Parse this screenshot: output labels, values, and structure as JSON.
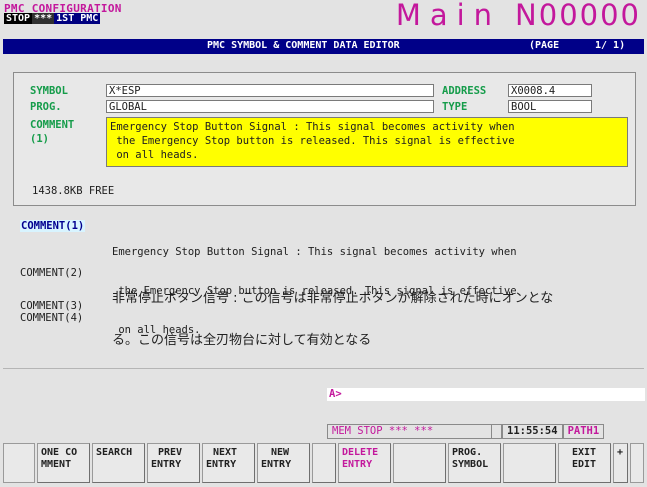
{
  "header": {
    "title": "PMC CONFIGURATION",
    "mode": "STOP",
    "mode_flags": "***",
    "pmc": "1ST PMC",
    "program_label": "Main",
    "program_number": "N00000"
  },
  "title_bar": {
    "title": "PMC SYMBOL & COMMENT DATA EDITOR",
    "page_label": "(PAGE",
    "page_value": "1/  1)"
  },
  "editor": {
    "symbol_label": "SYMBOL",
    "symbol_value": "X*ESP",
    "address_label": "ADDRESS",
    "address_value": "X0008.4",
    "prog_label": "PROG.",
    "prog_value": "GLOBAL",
    "type_label": "TYPE",
    "type_value": "BOOL",
    "comment_label": "COMMENT",
    "comment_index": "(1)",
    "comment_lines": [
      "Emergency Stop Button Signal : This signal becomes activity when",
      " the Emergency Stop button is released. This signal is effective",
      " on all heads."
    ],
    "free_memory": "1438.8KB FREE"
  },
  "comments": [
    {
      "label": "COMMENT(1)",
      "lines": [
        "Emergency Stop Button Signal : This signal becomes activity when",
        " the Emergency Stop button is released. This signal is effective",
        " on all heads."
      ]
    },
    {
      "label": "COMMENT(2)",
      "lines": [
        "非常停止ボタン信号 : この信号は非常停止ボタンが解除された時にオンとな",
        "る。この信号は全刃物台に対して有効となる"
      ]
    },
    {
      "label": "COMMENT(3)",
      "lines": []
    },
    {
      "label": "COMMENT(4)",
      "lines": []
    }
  ],
  "input_prompt": "A>",
  "status_bar": {
    "mode": "MEM  STOP *** ***",
    "time": "11:55:54",
    "path": "PATH1"
  },
  "softkeys": [
    {
      "line1": "ONE CO",
      "line2": "MMENT"
    },
    {
      "line1": "SEARCH",
      "line2": ""
    },
    {
      "line1": "PREV",
      "line2": "ENTRY"
    },
    {
      "line1": "NEXT",
      "line2": "ENTRY"
    },
    {
      "line1": "NEW",
      "line2": "ENTRY"
    },
    {
      "line1": "",
      "line2": ""
    },
    {
      "line1": "DELETE",
      "line2": "ENTRY"
    },
    {
      "line1": "",
      "line2": ""
    },
    {
      "line1": "PROG.",
      "line2": "SYMBOL"
    },
    {
      "line1": "",
      "line2": ""
    },
    {
      "line1": "EXIT",
      "line2": "EDIT"
    },
    {
      "line1": "+",
      "line2": ""
    }
  ],
  "colors": {
    "accent_magenta": "#c3189c",
    "title_bar_blue": "#000088",
    "label_green": "#159c4a",
    "comment_highlight": "#ffff00"
  }
}
